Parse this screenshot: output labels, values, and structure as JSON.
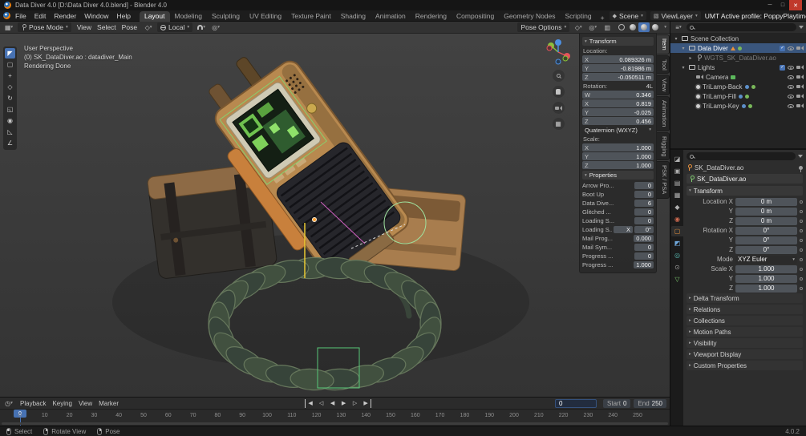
{
  "window": {
    "title": "Data Diver 4.0 [D:\\Data Diver 4.0.blend] - Blender 4.0"
  },
  "topbar": {
    "menus": [
      "File",
      "Edit",
      "Render",
      "Window",
      "Help"
    ],
    "workspaces": [
      "Layout",
      "Modeling",
      "Sculpting",
      "UV Editing",
      "Texture Paint",
      "Shading",
      "Animation",
      "Rendering",
      "Compositing",
      "Geometry Nodes",
      "Scripting"
    ],
    "active_workspace": "Layout",
    "add_tab": "+",
    "scene": "Scene",
    "view_layer": "ViewLayer",
    "profile": "UMT Active profile: PoppyPlaytime"
  },
  "viewport_header": {
    "mode": "Pose Mode",
    "menus": [
      "View",
      "Select",
      "Pose"
    ],
    "orientation": "Local",
    "pose_options": "Pose Options"
  },
  "viewport_toolbar": {
    "tools": [
      "tweak-select",
      "select-box",
      "cursor",
      "move",
      "rotate",
      "scale",
      "transform",
      "annotate",
      "measure"
    ],
    "active": "tweak-select"
  },
  "viewport_overlay": {
    "lines": [
      "User Perspective",
      "(0) SK_DataDiver.ao : datadiver_Main",
      "Rendering Done"
    ]
  },
  "npanel": {
    "tabs": [
      "Item",
      "Tool",
      "View",
      "Animation",
      "Rigging",
      "PSK / PSA"
    ],
    "active_tab": "Item",
    "transform_header": "Transform",
    "location_label": "Location:",
    "location": [
      [
        "X",
        "0.089326 m"
      ],
      [
        "Y",
        "-0.81986 m"
      ],
      [
        "Z",
        "-0.050511 m"
      ]
    ],
    "rotation_label": "Rotation:",
    "rotation_lock": "4L",
    "rotation": [
      [
        "W",
        "0.346"
      ],
      [
        "X",
        "0.819"
      ],
      [
        "Y",
        "-0.025"
      ],
      [
        "Z",
        "0.456"
      ]
    ],
    "rotation_mode": "Quaternion (WXYZ)",
    "scale_label": "Scale:",
    "scale": [
      [
        "X",
        "1.000"
      ],
      [
        "Y",
        "1.000"
      ],
      [
        "Z",
        "1.000"
      ]
    ],
    "properties_header": "Properties",
    "custom_props": [
      {
        "label": "Arrow Pro...",
        "values": [
          "0"
        ]
      },
      {
        "label": "Boot Up",
        "values": [
          "0"
        ]
      },
      {
        "label": "Data Dive...",
        "values": [
          "6"
        ]
      },
      {
        "label": "Glitched ...",
        "values": [
          "0"
        ]
      },
      {
        "label": "Loading S...",
        "values": [
          "0"
        ]
      },
      {
        "label": "Loading S...",
        "values": [
          "X",
          "0°"
        ]
      },
      {
        "label": "Mail Prog...",
        "values": [
          "0.000"
        ]
      },
      {
        "label": "Mail Sym...",
        "values": [
          "0"
        ]
      },
      {
        "label": "Progress ...",
        "values": [
          "0"
        ]
      },
      {
        "label": "Progress ...",
        "values": [
          "1.000"
        ]
      }
    ]
  },
  "outliner": {
    "rows": [
      {
        "depth": 0,
        "caret": "▾",
        "icon": "collection",
        "label": "Scene Collection",
        "inline": [],
        "right": []
      },
      {
        "depth": 1,
        "caret": "▾",
        "icon": "collection",
        "label": "Data Diver",
        "selected": true,
        "inline": [
          "mesh-triangle",
          "dot-green"
        ],
        "right": [
          "checkbox",
          "eye",
          "camera"
        ]
      },
      {
        "depth": 2,
        "caret": "▸",
        "icon": "armature",
        "label": "WGTS_SK_DataDiver.ao",
        "dim": true,
        "inline": [],
        "right": []
      },
      {
        "depth": 1,
        "caret": "▾",
        "icon": "collection",
        "label": "Lights",
        "inline": [],
        "right": [
          "checkbox",
          "eye",
          "camera"
        ]
      },
      {
        "depth": 2,
        "caret": "",
        "icon": "camera",
        "label": "Camera",
        "inline": [
          "screen-green"
        ],
        "right": [
          "eye",
          "camera"
        ]
      },
      {
        "depth": 2,
        "caret": "",
        "icon": "light",
        "label": "TriLamp-Back",
        "inline": [
          "dot-blue",
          "dot-green"
        ],
        "right": [
          "eye",
          "camera"
        ]
      },
      {
        "depth": 2,
        "caret": "",
        "icon": "light",
        "label": "TriLamp-Fill",
        "inline": [
          "dot-blue",
          "dot-green"
        ],
        "right": [
          "eye",
          "camera"
        ]
      },
      {
        "depth": 2,
        "caret": "",
        "icon": "light",
        "label": "TriLamp-Key",
        "inline": [
          "dot-blue",
          "dot-green"
        ],
        "right": [
          "eye",
          "camera"
        ]
      }
    ]
  },
  "properties_editor": {
    "breadcrumb": "SK_DataDiver.ao",
    "object_name": "SK_DataDiver.ao",
    "transform_header": "Transform",
    "rows": [
      {
        "label": "Location X",
        "value": "0 m"
      },
      {
        "label": "Y",
        "value": "0 m"
      },
      {
        "label": "Z",
        "value": "0 m"
      },
      {
        "label": "Rotation X",
        "value": "0°"
      },
      {
        "label": "Y",
        "value": "0°"
      },
      {
        "label": "Z",
        "value": "0°"
      },
      {
        "label": "Mode",
        "value": "XYZ Euler",
        "dropdown": true
      },
      {
        "label": "Scale X",
        "value": "1.000"
      },
      {
        "label": "Y",
        "value": "1.000"
      },
      {
        "label": "Z",
        "value": "1.000"
      }
    ],
    "sections": [
      "Delta Transform",
      "Relations",
      "Collections",
      "Motion Paths",
      "Visibility",
      "Viewport Display",
      "Custom Properties"
    ],
    "tabs": [
      "tool",
      "render",
      "output",
      "view-layer",
      "scene",
      "world",
      "object",
      "modifiers",
      "physics",
      "constraints",
      "object-data"
    ],
    "active_tab": "object"
  },
  "timeline": {
    "menus": [
      "Playback",
      "Keying",
      "View",
      "Marker"
    ],
    "current_frame": "0",
    "playhead_frame": "0",
    "start_label": "Start",
    "start": "0",
    "end_label": "End",
    "end": "250",
    "tick_start": 0,
    "tick_end": 250,
    "tick_step": 10
  },
  "statusbar": {
    "items": [
      {
        "icon": "left-mouse",
        "label": "Select"
      },
      {
        "icon": "middle-mouse",
        "label": "Rotate View"
      },
      {
        "icon": "right-mouse",
        "label": "Pose"
      }
    ],
    "version": "4.0.2"
  },
  "icons": {
    "search": "magnifier",
    "filter": "funnel",
    "snap": "magnet",
    "orientation": "globe",
    "visibility": "eye",
    "render-visibility": "camera",
    "include": "checkbox",
    "pin": "pin"
  }
}
